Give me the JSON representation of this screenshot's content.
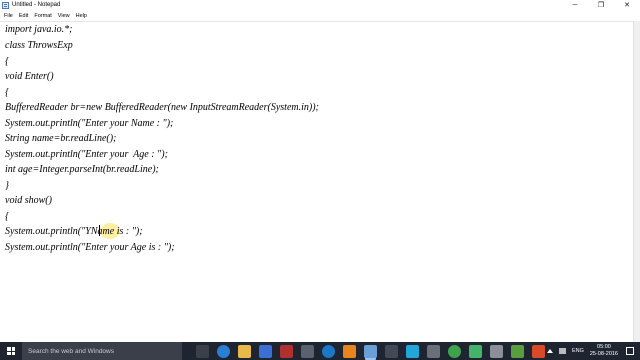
{
  "window": {
    "title": "Untitled - Notepad",
    "controls": {
      "minimize": "─",
      "maximize": "❐",
      "close": "✕"
    }
  },
  "menu": {
    "items": [
      "File",
      "Edit",
      "Format",
      "View",
      "Help"
    ]
  },
  "editor": {
    "lines": [
      "import java.io.*;",
      "class ThrowsExp",
      "{",
      "void Enter()",
      "{",
      "BufferedReader br=new BufferedReader(new InputStreamReader(System.in));",
      "System.out.println(\"Enter your Name : \");",
      "String name=br.readLine();",
      "System.out.println(\"Enter your  Age : \");",
      "int age=Integer.parseInt(br.readLine);",
      "}",
      "void show()",
      "{",
      "System.out.println(\"YName is : \");",
      "System.out.println(\"Enter your Age is : \");"
    ]
  },
  "taskbar": {
    "search_placeholder": "Search the web and Windows",
    "apps": [
      {
        "icon": "task-view-icon",
        "color": "#3a3f4a"
      },
      {
        "icon": "edge-icon",
        "color": "#2a7fd4"
      },
      {
        "icon": "file-explorer-icon",
        "color": "#e8b84a"
      },
      {
        "icon": "store-icon",
        "color": "#3b6fd1"
      },
      {
        "icon": "app-icon",
        "color": "#b03030"
      },
      {
        "icon": "app-icon",
        "color": "#5a6270"
      },
      {
        "icon": "hp-icon",
        "color": "#1b77c8"
      },
      {
        "icon": "vlc-icon",
        "color": "#e8851e"
      },
      {
        "icon": "notepad-icon",
        "color": "#6a9fd8"
      },
      {
        "icon": "app-icon",
        "color": "#444a55"
      },
      {
        "icon": "app-icon",
        "color": "#23a7d8"
      },
      {
        "icon": "calculator-icon",
        "color": "#6b6f78"
      },
      {
        "icon": "chrome-icon",
        "color": "#3fa34d"
      },
      {
        "icon": "app-icon",
        "color": "#44b46b"
      },
      {
        "icon": "app-icon",
        "color": "#8a8f98"
      },
      {
        "icon": "app-icon",
        "color": "#5a9f3f"
      },
      {
        "icon": "app-icon",
        "color": "#d84a2a"
      }
    ],
    "tray": {
      "language": "ENG",
      "time": "05:00",
      "date": "25-08-2016"
    }
  }
}
